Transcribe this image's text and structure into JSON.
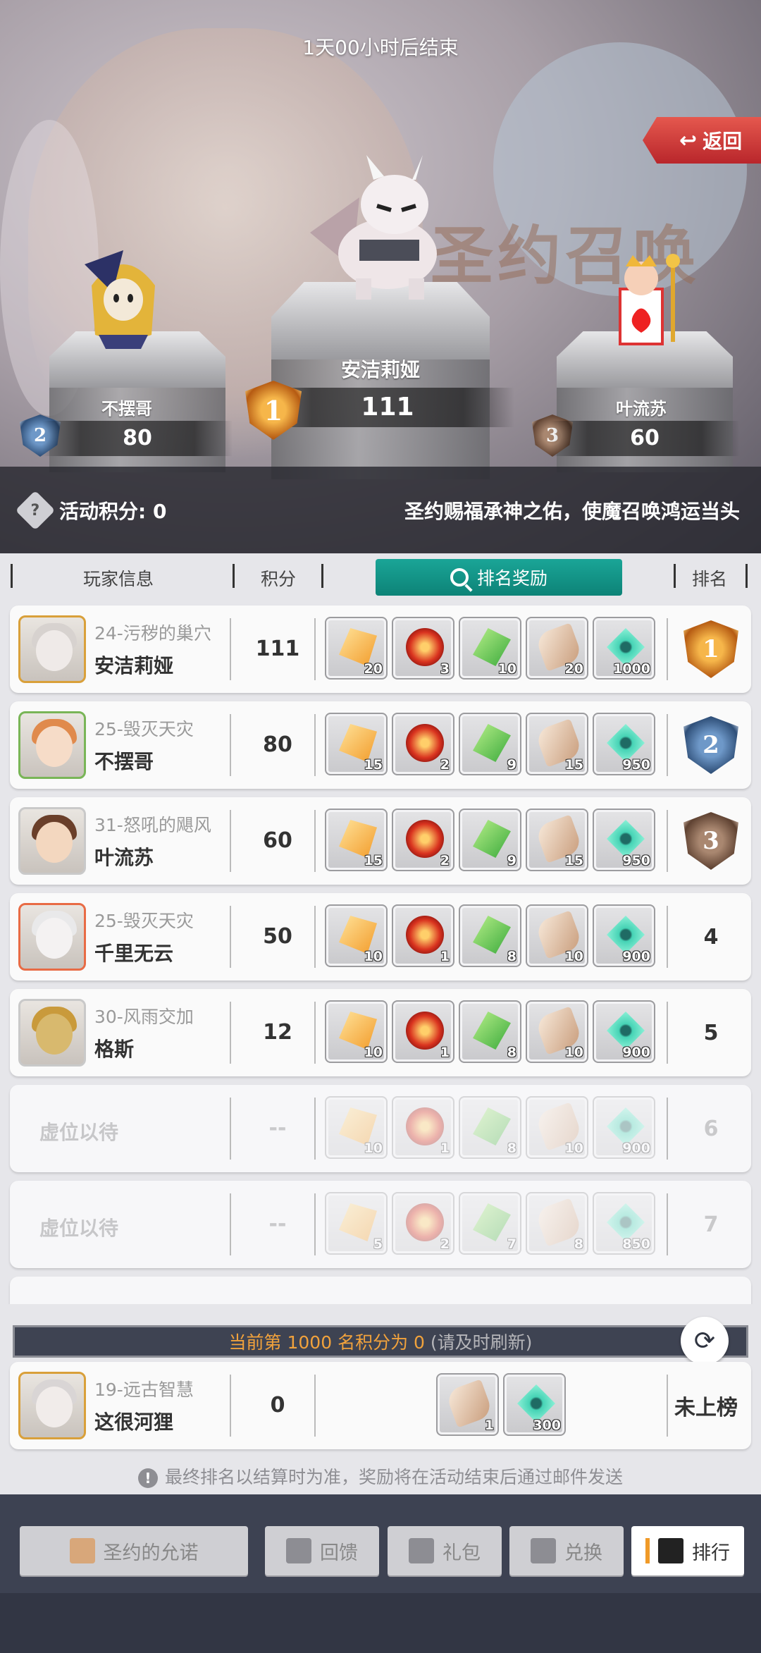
{
  "timer": "1天00小时后结束",
  "back_label": "返回",
  "event_title": "圣约召唤",
  "podium": [
    {
      "name": "不摆哥",
      "score": "80",
      "rank": "2"
    },
    {
      "name": "安洁莉娅",
      "score": "111",
      "rank": "1"
    },
    {
      "name": "叶流苏",
      "score": "60",
      "rank": "3"
    }
  ],
  "info_bar": {
    "points_label": "活动积分: 0",
    "slogan": "圣约赐福承神之佑，使魔召唤鸿运当头"
  },
  "header": {
    "player_info": "玩家信息",
    "score": "积分",
    "rank_reward": "排名奖励",
    "rank": "排名"
  },
  "rows": [
    {
      "server": "24-污秽的巢穴",
      "name": "安洁莉娅",
      "score": "111",
      "rank": "1",
      "rewards": [
        "20",
        "3",
        "10",
        "20",
        "1000"
      ]
    },
    {
      "server": "25-毁灭天灾",
      "name": "不摆哥",
      "score": "80",
      "rank": "2",
      "rewards": [
        "15",
        "2",
        "9",
        "15",
        "950"
      ]
    },
    {
      "server": "31-怒吼的飓风",
      "name": "叶流苏",
      "score": "60",
      "rank": "3",
      "rewards": [
        "15",
        "2",
        "9",
        "15",
        "950"
      ]
    },
    {
      "server": "25-毁灭天灾",
      "name": "千里无云",
      "score": "50",
      "rank": "4",
      "rewards": [
        "10",
        "1",
        "8",
        "10",
        "900"
      ]
    },
    {
      "server": "30-风雨交加",
      "name": "格斯",
      "score": "12",
      "rank": "5",
      "rewards": [
        "10",
        "1",
        "8",
        "10",
        "900"
      ]
    },
    {
      "placeholder": "虚位以待",
      "score": "--",
      "rank": "6",
      "rewards": [
        "10",
        "1",
        "8",
        "10",
        "900"
      ]
    },
    {
      "placeholder": "虚位以待",
      "score": "--",
      "rank": "7",
      "rewards": [
        "5",
        "2",
        "7",
        "8",
        "850"
      ]
    }
  ],
  "cutoff": {
    "text": "当前第 1000 名积分为 0",
    "hint": "(请及时刷新)"
  },
  "my_row": {
    "server": "19-远古智慧",
    "name": "这很河狸",
    "score": "0",
    "rank": "未上榜",
    "rewards": [
      "1",
      "300"
    ]
  },
  "notice": "最终排名以结算时为准，奖励将在活动结束后通过邮件发送",
  "nav": {
    "promise": "圣约的允诺",
    "feedback": "回馈",
    "gift": "礼包",
    "exchange": "兑换",
    "ranking": "排行"
  },
  "colors": {
    "accent_teal": "#1aa597",
    "gold_text": "#f1a23c",
    "back_red": "#d33a35"
  }
}
